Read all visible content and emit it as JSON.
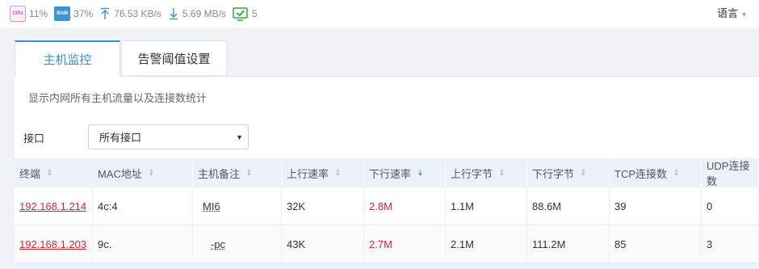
{
  "status_bar": {
    "cpu_icon_text": "CPU",
    "cpu_value": "11%",
    "ram_icon_text": "RAM",
    "ram_value": "37%",
    "upload_speed": "76.53 KB/s",
    "download_speed": "5.69 MB/s",
    "online_count": "5",
    "language_label": "语言"
  },
  "tabs": [
    {
      "label": "主机监控",
      "active": true
    },
    {
      "label": "告警阈值设置",
      "active": false
    }
  ],
  "description": "显示内网所有主机流量以及连接数统计",
  "filter": {
    "label": "接口",
    "selected": "所有接口"
  },
  "table": {
    "columns": [
      "终端",
      "MAC地址",
      "主机备注",
      "上行速率",
      "下行速率",
      "上行字节",
      "下行字节",
      "TCP连接数",
      "UDP连接数"
    ],
    "rows": [
      [
        "192.168.1.214",
        "4c:4",
        "MI6",
        "32K",
        "2.8M",
        "1.1M",
        "88.6M",
        "39",
        "0"
      ],
      [
        "192.168.1.203",
        "9c.",
        "-pc",
        "43K",
        "2.7M",
        "2.1M",
        "111.2M",
        "85",
        "3"
      ]
    ]
  },
  "colors": {
    "accent": "#3c8ddb",
    "alert_red": "#d9262c",
    "header_bg": "#eaf1f9"
  }
}
